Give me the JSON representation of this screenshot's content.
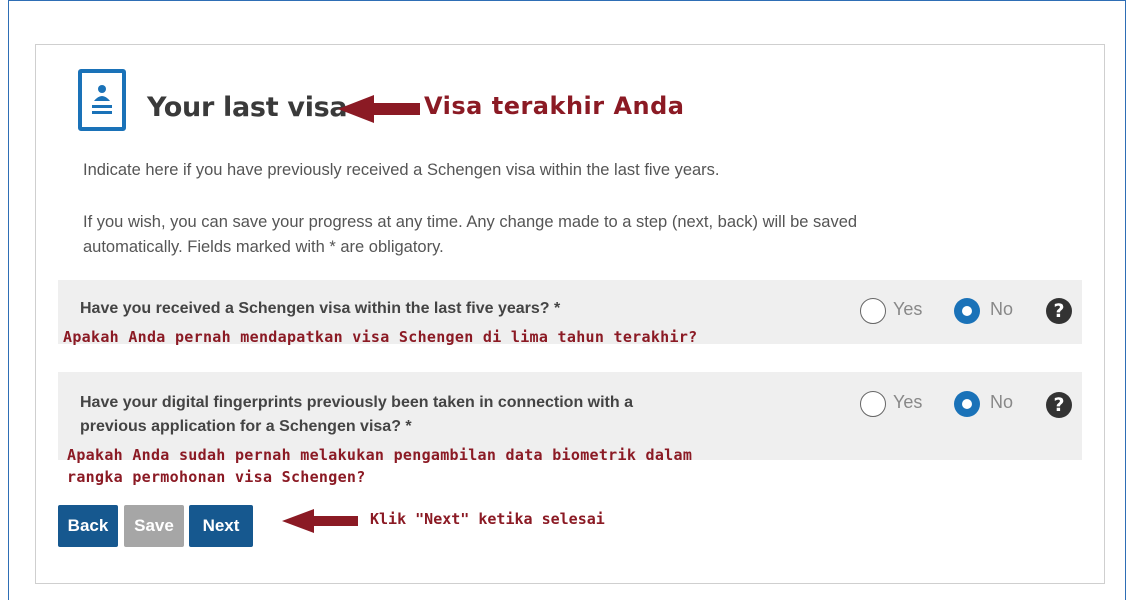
{
  "page": {
    "title": "Your last visa",
    "intro_line1": "Indicate here if you have previously received a Schengen visa within the last five years.",
    "intro_line2": "If you wish, you can save your progress at any time. Any change made to a step (next, back) will be saved automatically. Fields marked with * are obligatory."
  },
  "annotations": {
    "title": "Visa terakhir Anda",
    "question1": "Apakah Anda pernah mendapatkan visa Schengen di lima tahun terakhir?",
    "question2_line1": "Apakah Anda sudah pernah melakukan pengambilan data biometrik dalam",
    "question2_line2": "rangka permohonan visa Schengen?",
    "next": "Klik \"Next\" ketika selesai",
    "color": "#8b1a24"
  },
  "questions": [
    {
      "text": "Have you received a Schengen visa within the last five years? *",
      "options": [
        "Yes",
        "No"
      ],
      "selected": "No"
    },
    {
      "text_line1": "Have your digital fingerprints previously been taken in connection with a",
      "text_line2": "previous application for a Schengen visa? *",
      "options": [
        "Yes",
        "No"
      ],
      "selected": "No"
    }
  ],
  "buttons": {
    "back": "Back",
    "save": "Save",
    "next": "Next"
  },
  "icons": {
    "page_icon": "document-person-icon",
    "help": "help-question-icon",
    "help_glyph": "?"
  },
  "colors": {
    "accent": "#1a72b8",
    "button_primary": "#16588f",
    "button_disabled": "#a6a6a6",
    "row_background": "#efefef"
  }
}
